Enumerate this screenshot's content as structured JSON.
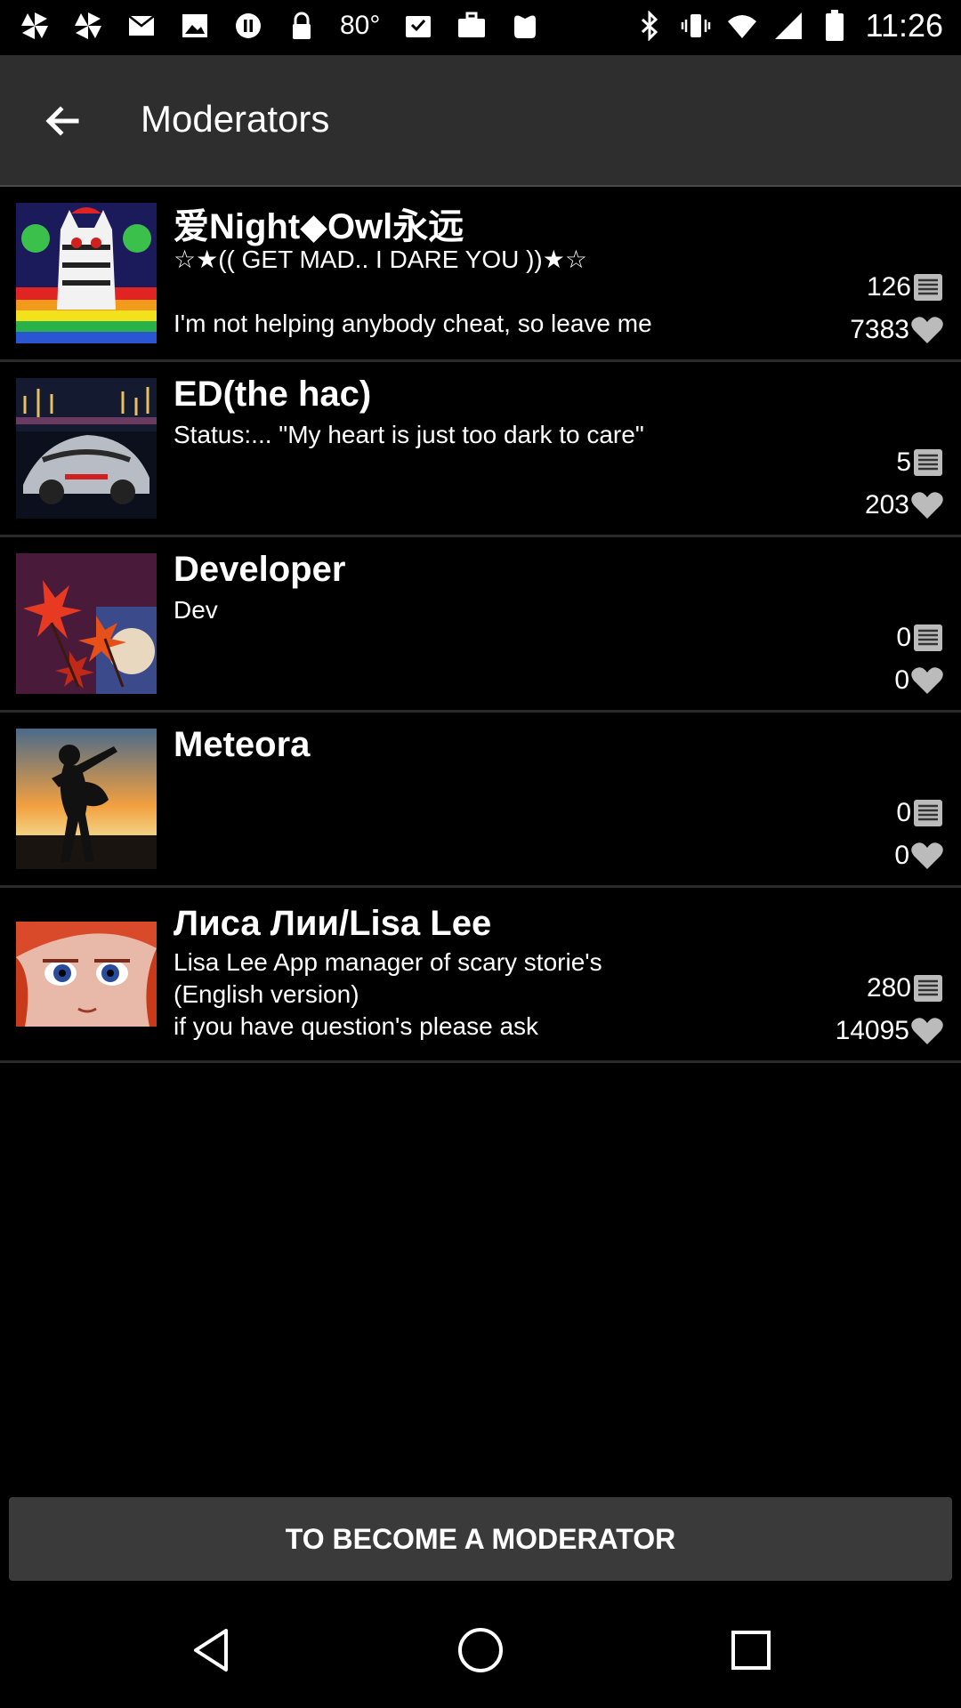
{
  "status_bar": {
    "temperature": "80°",
    "time": "11:26",
    "icons": [
      "pinwheel-icon",
      "pinwheel-icon",
      "mail-icon",
      "gallery-icon",
      "circle-pause-icon",
      "lock-icon",
      "inbox-icon",
      "briefcase-icon",
      "bag-icon",
      "bluetooth-icon",
      "vibrate-icon",
      "wifi-icon",
      "signal-icon",
      "battery-icon"
    ]
  },
  "header": {
    "title": "Moderators",
    "back_icon": "arrow-left-icon"
  },
  "moderators": [
    {
      "name": "爱Night◆Owl永远",
      "lines": [
        "☆★(( GET MAD.. I DARE YOU ))★☆",
        "",
        "I'm not helping anybody cheat, so leave me"
      ],
      "posts": "126",
      "likes": "7383"
    },
    {
      "name": "ED(the hac)",
      "lines": [
        "Status:... \"My heart is just too dark to care\""
      ],
      "posts": "5",
      "likes": "203"
    },
    {
      "name": "Developer",
      "lines": [
        "Dev"
      ],
      "posts": "0",
      "likes": "0"
    },
    {
      "name": "Meteora",
      "lines": [],
      "posts": "0",
      "likes": "0"
    },
    {
      "name": "Лиса Лии/Lisa Lee",
      "lines": [
        "Lisa Lee App manager of scary storie's",
        "(English version)",
        "if you have question's please ask"
      ],
      "posts": "280",
      "likes": "14095"
    }
  ],
  "footer": {
    "button_label": "TO BECOME A MODERATOR"
  },
  "colors": {
    "background": "#000000",
    "header": "#2e2e2e",
    "button": "#3a3a3a",
    "text": "#ffffff"
  }
}
